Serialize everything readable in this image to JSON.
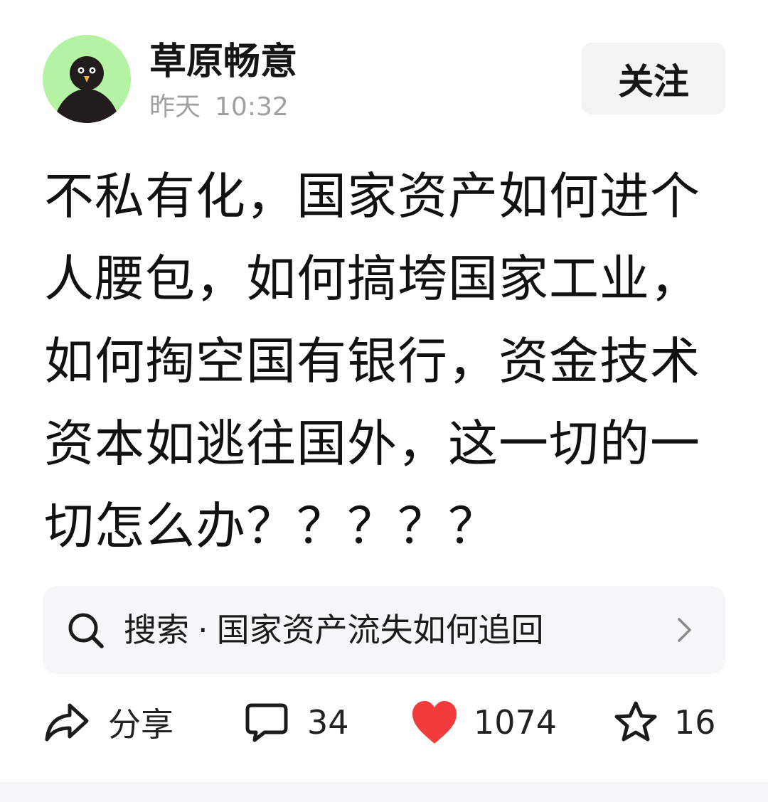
{
  "header": {
    "author_name": "草原畅意",
    "time_day": "昨天",
    "time_clock": "10:32",
    "follow_label": "关注"
  },
  "post": {
    "text": "不私有化，国家资产如何进个人腰包，如何搞垮国家工业，如何掏空国有银行，资金技术资本如逃往国外，这一切的一切怎么办？？？？？"
  },
  "search": {
    "prefix": "搜索",
    "separator": "·",
    "query": "国家资产流失如何追回"
  },
  "actions": {
    "share_label": "分享",
    "comment_count": "34",
    "like_count": "1074",
    "favorite_count": "16"
  },
  "colors": {
    "avatar_bg": "#b5f3a4",
    "like_heart": "#f23b3b",
    "follow_bg": "#f3f3f3",
    "search_bg": "#f6f6f8",
    "meta_text": "#a0a0a0"
  },
  "icons": [
    "search-icon",
    "chevron-right-icon",
    "share-icon",
    "comment-icon",
    "heart-icon",
    "star-icon"
  ]
}
